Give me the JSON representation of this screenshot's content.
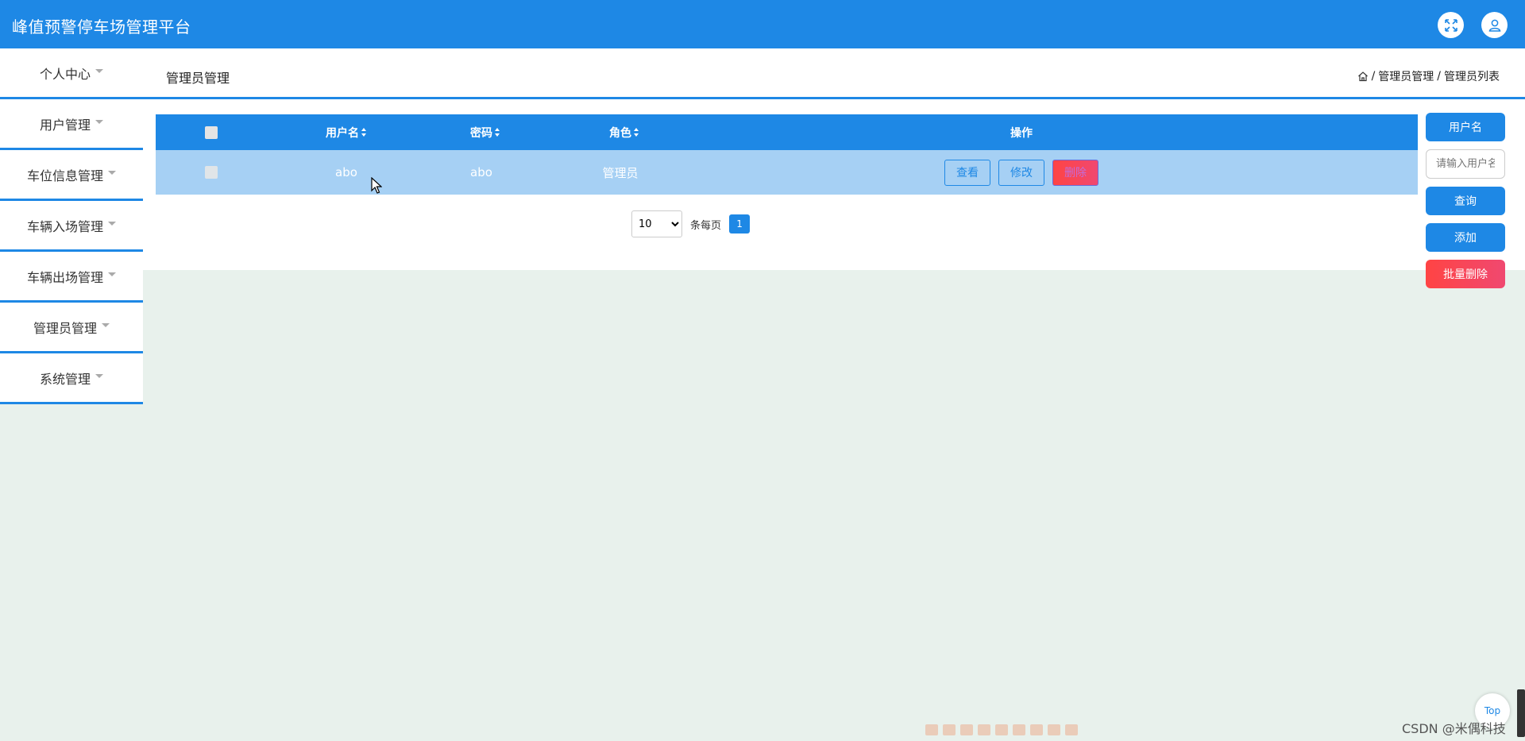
{
  "app": {
    "title": "峰值预警停车场管理平台"
  },
  "header_icons": {
    "fullscreen": "expand-icon",
    "user": "user-icon"
  },
  "sidebar": {
    "items": [
      {
        "label": "个人中心"
      },
      {
        "label": "用户管理"
      },
      {
        "label": "车位信息管理"
      },
      {
        "label": "车辆入场管理"
      },
      {
        "label": "车辆出场管理"
      },
      {
        "label": "管理员管理"
      },
      {
        "label": "系统管理"
      }
    ]
  },
  "page": {
    "title": "管理员管理",
    "breadcrumb": {
      "sep": "/",
      "items": [
        "管理员管理",
        "管理员列表"
      ]
    }
  },
  "table": {
    "columns": {
      "username": "用户名",
      "password": "密码",
      "role": "角色",
      "actions": "操作"
    },
    "rows": [
      {
        "username": "abo",
        "password": "abo",
        "role": "管理员"
      }
    ],
    "actions": {
      "view": "查看",
      "edit": "修改",
      "delete": "删除"
    }
  },
  "pagination": {
    "page_size": "10",
    "page_size_options": [
      "10"
    ],
    "per_page_label": "条每页",
    "current_page": "1"
  },
  "search": {
    "label": "用户名",
    "placeholder": "请输入用户名",
    "query_button": "查询",
    "add_button": "添加",
    "batch_delete_button": "批量删除"
  },
  "footer": {
    "top_button": "Top",
    "watermark": "CSDN @米偶科技"
  },
  "colors": {
    "primary": "#1e88e5",
    "danger": "#ff4444",
    "row_bg": "#a6d0f4",
    "page_bg": "#e8f1ec"
  }
}
